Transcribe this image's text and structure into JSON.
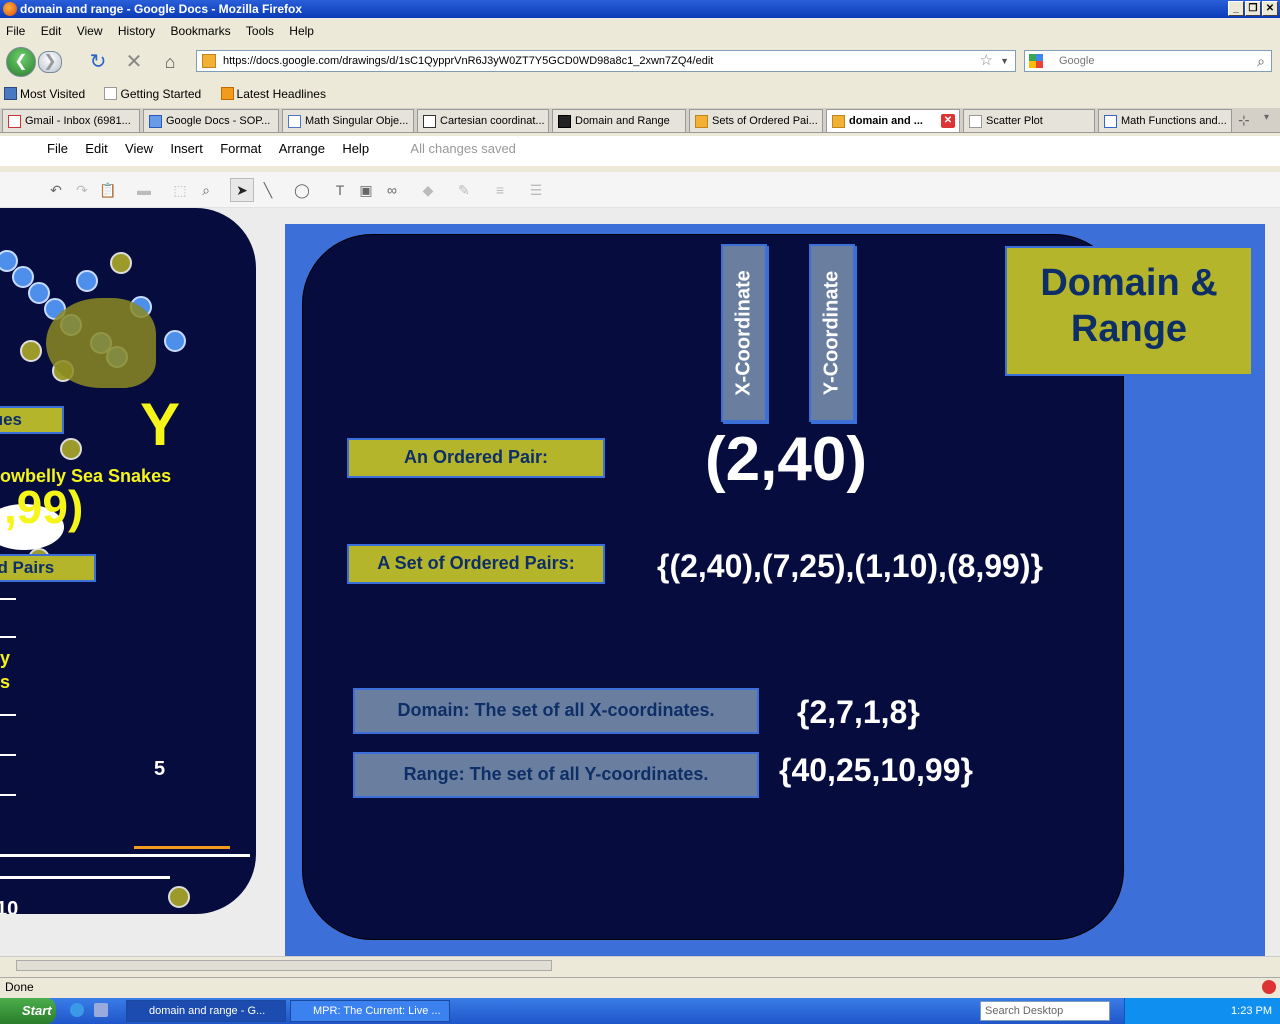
{
  "window": {
    "title": "domain and range - Google Docs - Mozilla Firefox"
  },
  "browser_menu": [
    "File",
    "Edit",
    "View",
    "History",
    "Bookmarks",
    "Tools",
    "Help"
  ],
  "url": "https://docs.google.com/drawings/d/1sC1QypprVnR6J3yW0ZT7Y5GCD0WD98a8c1_2xwn7ZQ4/edit",
  "search_placeholder": "Google",
  "bookmarks": [
    "Most Visited",
    "Getting Started",
    "Latest Headlines"
  ],
  "tabs": [
    {
      "label": "Gmail - Inbox (6981..."
    },
    {
      "label": "Google Docs - SOP..."
    },
    {
      "label": "Math Singular Obje..."
    },
    {
      "label": "Cartesian coordinat..."
    },
    {
      "label": "Domain and Range"
    },
    {
      "label": "Sets of Ordered Pai..."
    },
    {
      "label": "domain and ..."
    },
    {
      "label": "Scatter Plot"
    },
    {
      "label": "Math Functions and..."
    }
  ],
  "doc_menu": [
    "File",
    "Edit",
    "View",
    "Insert",
    "Format",
    "Arrange",
    "Help"
  ],
  "save_status": "All changes saved",
  "left_slide": {
    "big_letter": "Y",
    "values_label": "lues",
    "caption": "owbelly Sea Snakes",
    "pair_text": ",99)",
    "pairs_label": "ed Pairs",
    "side_text_1": "y",
    "side_text_2": "s",
    "tick_5": "5",
    "tick_10": "10"
  },
  "main_slide": {
    "x_label": "X-Coordinate",
    "y_label": "Y-Coordinate",
    "title_line1": "Domain &",
    "title_line2": "Range",
    "ordered_pair_label": "An Ordered Pair:",
    "ordered_pair": "(2,40)",
    "set_label": "A Set of Ordered Pairs:",
    "set_value": "{(2,40),(7,25),(1,10),(8,99)}",
    "domain_label": "Domain: The set of all X-coordinates.",
    "domain_value": "{2,7,1,8}",
    "range_label": "Range: The set of all Y-coordinates.",
    "range_value": "{40,25,10,99}"
  },
  "status": "Done",
  "taskbar": {
    "start": "Start",
    "tasks": [
      "domain and range - G...",
      "MPR: The Current: Live ..."
    ],
    "desktop_search": "Search Desktop",
    "clock": "1:23 PM"
  },
  "colors": {
    "slide_bg": "#070c3e",
    "accent_blue": "#3d6fd8",
    "label_yellow": "#b5b52b",
    "label_gray": "#6a7fa0"
  }
}
